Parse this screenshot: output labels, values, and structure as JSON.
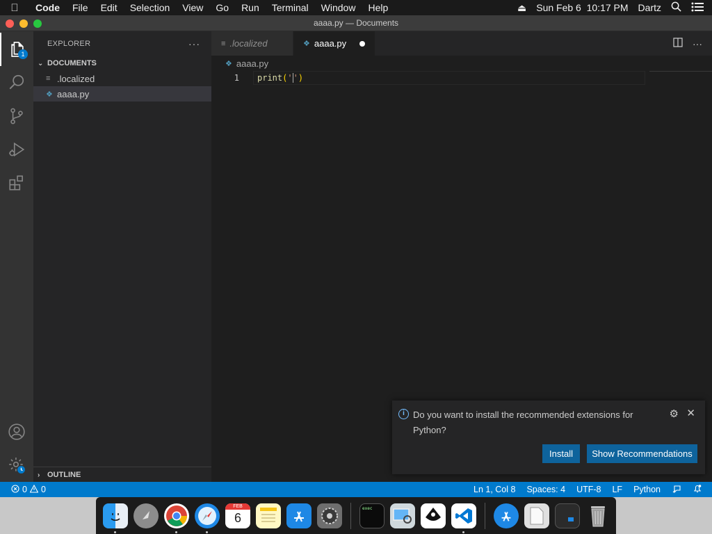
{
  "menubar": {
    "app_name": "Code",
    "items": [
      "File",
      "Edit",
      "Selection",
      "View",
      "Go",
      "Run",
      "Terminal",
      "Window",
      "Help"
    ],
    "datetime": "Sun Feb 6  10:17 PM",
    "user": "Dartz"
  },
  "window": {
    "title": "aaaa.py — Documents"
  },
  "activity": {
    "explorer_badge": "1"
  },
  "sidebar": {
    "title": "EXPLORER",
    "more": "···",
    "section": "DOCUMENTS",
    "files": [
      {
        "name": ".localized"
      },
      {
        "name": "aaaa.py"
      }
    ],
    "outline": "OUTLINE"
  },
  "editor": {
    "tabs": [
      {
        "label": ".localized"
      },
      {
        "label": "aaaa.py"
      }
    ],
    "breadcrumb": "aaaa.py",
    "lines": [
      {
        "number": "1",
        "func": "print",
        "open": "(",
        "quote1": "'",
        "quote2": "'",
        "close": ")"
      }
    ]
  },
  "notification": {
    "message": "Do you want to install the recommended extensions for Python?",
    "install_label": "Install",
    "recommendations_label": "Show Recommendations"
  },
  "statusbar": {
    "errors": "0",
    "warnings": "0",
    "position": "Ln 1, Col 8",
    "spaces": "Spaces: 4",
    "encoding": "UTF-8",
    "eol": "LF",
    "language": "Python"
  },
  "dock": {
    "calendar_month": "FEB",
    "calendar_day": "6",
    "terminal_text": "exec"
  },
  "colors": {
    "accent": "#007acc",
    "button": "#0e639c",
    "editor_bg": "#1e1e1e",
    "sidebar_bg": "#252526"
  }
}
